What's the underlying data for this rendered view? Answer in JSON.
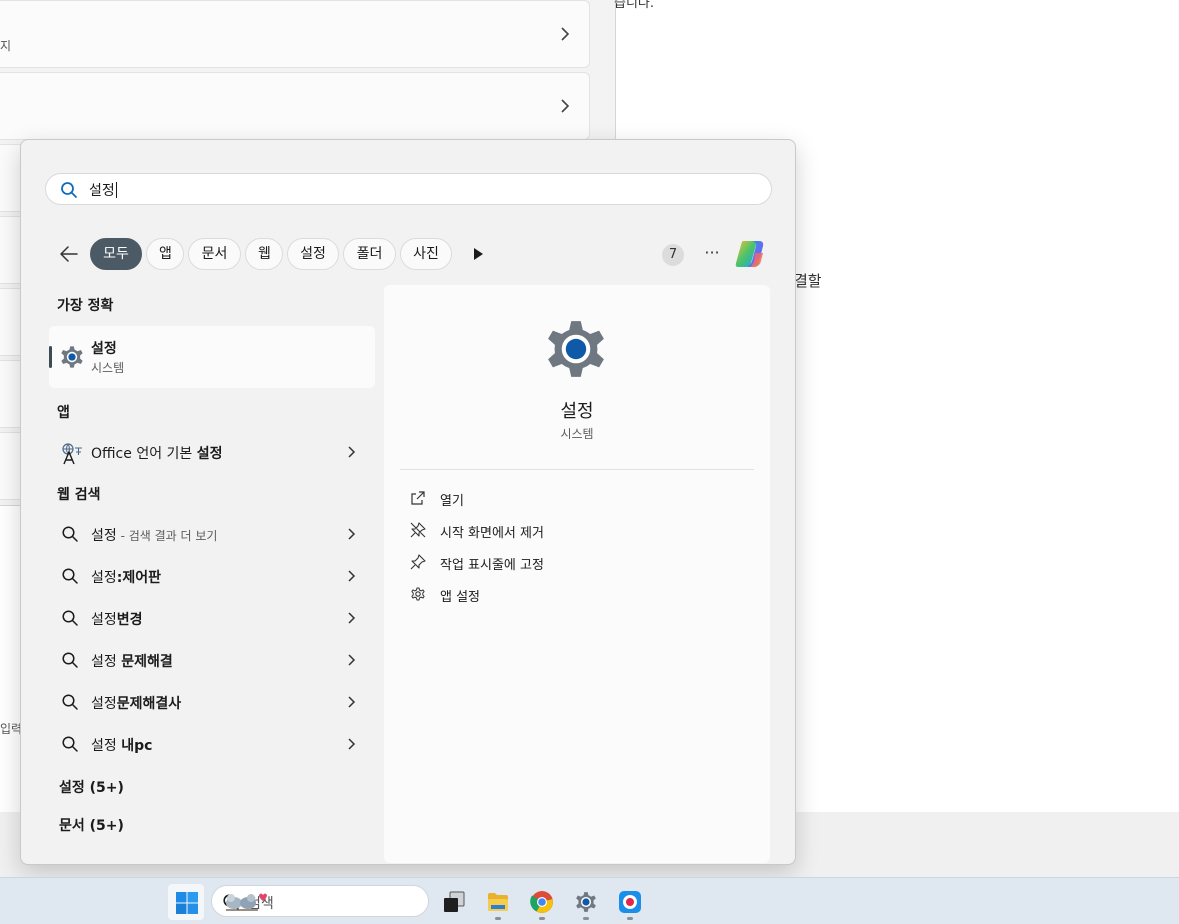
{
  "background": {
    "fragment_top": "습니다.",
    "fragment_card": "지",
    "fragment_right": "결할",
    "fragment_left": "입력"
  },
  "search": {
    "query": "설정",
    "back_label": "뒤로"
  },
  "filters": {
    "chips": [
      "모두",
      "앱",
      "문서",
      "웹",
      "설정",
      "폴더",
      "사진"
    ],
    "active": "모두",
    "count": "7",
    "more": "···"
  },
  "best_match": {
    "heading": "가장 정확",
    "title": "설정",
    "subtitle": "시스템"
  },
  "apps": {
    "heading": "앱",
    "items": [
      {
        "prefix": "Office 언어 기본 ",
        "bold": "설정"
      }
    ]
  },
  "web": {
    "heading": "웹 검색",
    "items": [
      {
        "prefix": "설정",
        "bold": "",
        "suffix": " - 검색 결과 더 보기"
      },
      {
        "prefix": "설정",
        "bold": ":제어판",
        "suffix": ""
      },
      {
        "prefix": "설정",
        "bold": "변경",
        "suffix": ""
      },
      {
        "prefix": "설정 ",
        "bold": "문제해결",
        "suffix": ""
      },
      {
        "prefix": "설정",
        "bold": "문제해결사",
        "suffix": ""
      },
      {
        "prefix": "설정 ",
        "bold": "내pc",
        "suffix": ""
      }
    ]
  },
  "more_sections": {
    "settings": "설정 (5+)",
    "documents": "문서 (5+)"
  },
  "detail": {
    "title": "설정",
    "subtitle": "시스템",
    "actions": [
      {
        "label": "열기",
        "icon": "open-external-icon"
      },
      {
        "label": "시작 화면에서 제거",
        "icon": "unpin-icon"
      },
      {
        "label": "작업 표시줄에 고정",
        "icon": "pin-icon"
      },
      {
        "label": "앱 설정",
        "icon": "gear-icon"
      }
    ]
  },
  "taskbar": {
    "search_placeholder": "검색"
  },
  "colors": {
    "active_chip": "#4b5a65",
    "gear_blue": "#0f5aa8",
    "taskbar": "#dfe8f1"
  }
}
